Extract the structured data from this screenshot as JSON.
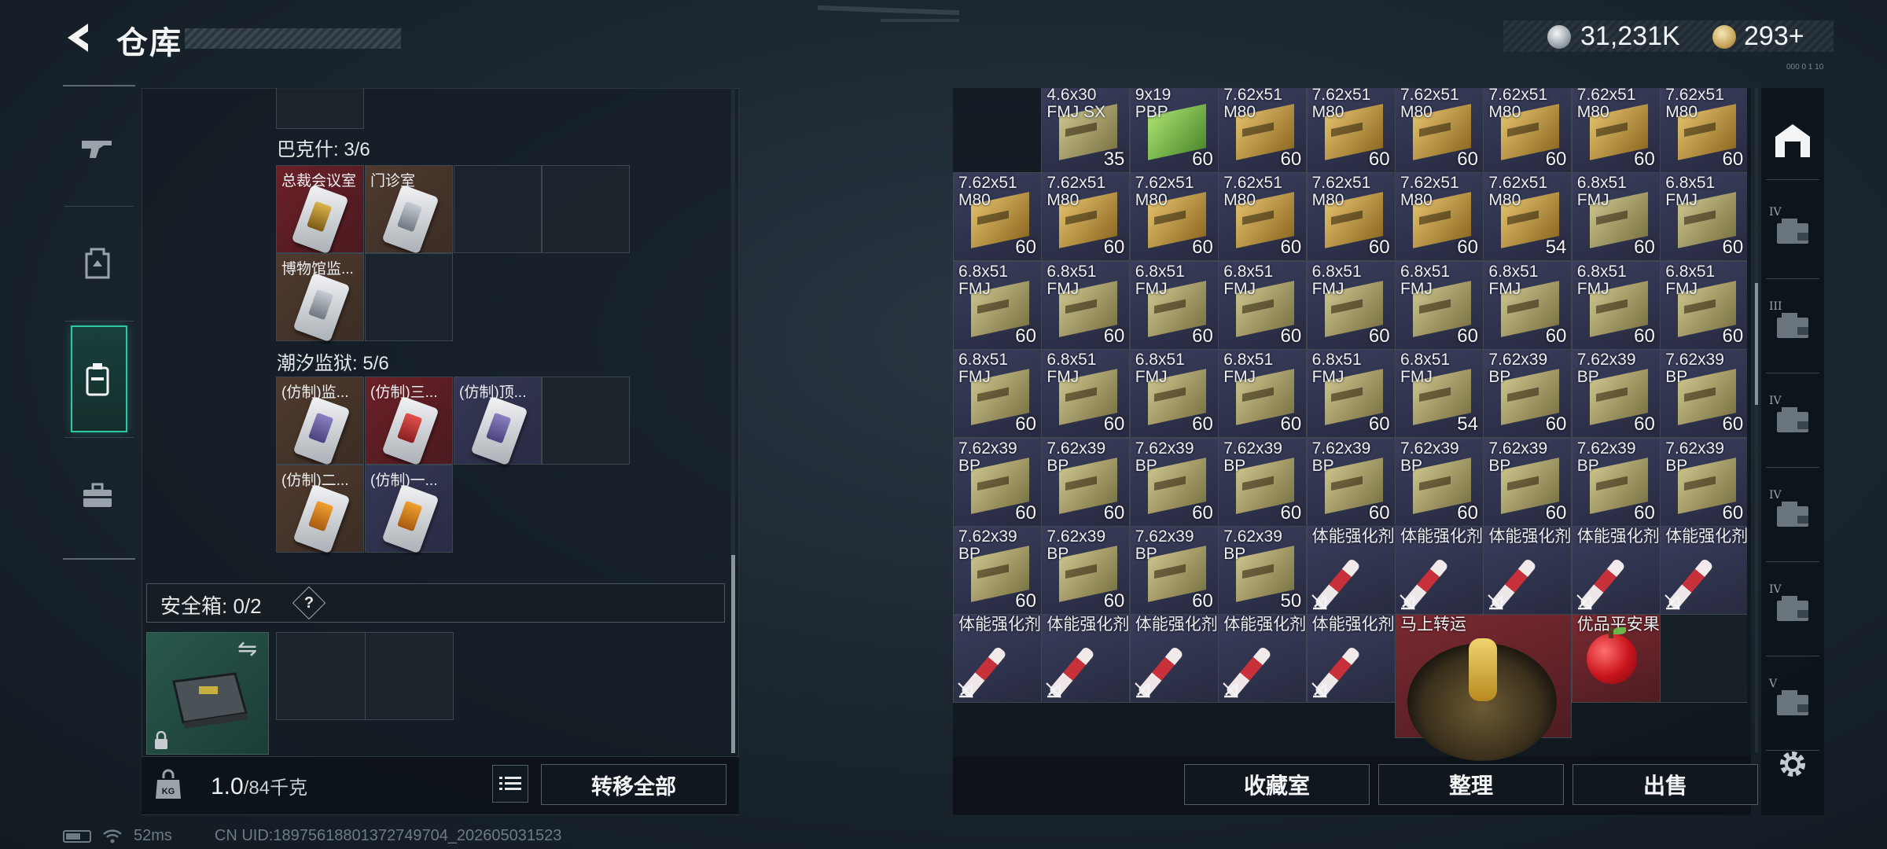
{
  "header": {
    "title": "仓库",
    "currency_silver": "31,231K",
    "currency_gold": "293",
    "plus": "+",
    "tiny": "000 0 1 10"
  },
  "sidebar": {
    "items": [
      "weapon-icon",
      "backpack-icon",
      "container-icon",
      "toolbox-icon"
    ]
  },
  "left": {
    "top_empty": "",
    "section1": {
      "label": "巴克什: 3/6",
      "items": [
        "总裁会议室",
        "门诊室",
        "博物馆监..."
      ]
    },
    "section2": {
      "label": "潮汐监狱: 5/6",
      "items": [
        "(仿制)监...",
        "(仿制)三...",
        "(仿制)顶...",
        "(仿制)二...",
        "(仿制)一..."
      ]
    },
    "safe_label": "安全箱: 0/2",
    "safe_help": "?",
    "swap": "⇋",
    "weight_value": "1.0",
    "weight_max": "/84千克",
    "transfer_all": "转移全部"
  },
  "status": {
    "ping": "52ms",
    "uid": "CN UID:18975618801372749704_202605031523"
  },
  "grid": {
    "rows": [
      [
        [
          "4.6x30\nFMJ SX",
          "35",
          "olive"
        ],
        [
          "9x19\nPBP",
          "60",
          "green"
        ],
        [
          "7.62x51\nM80",
          "60",
          "gold"
        ],
        [
          "7.62x51\nM80",
          "60",
          "gold"
        ],
        [
          "7.62x51\nM80",
          "60",
          "gold"
        ],
        [
          "7.62x51\nM80",
          "60",
          "gold"
        ],
        [
          "7.62x51\nM80",
          "60",
          "gold"
        ],
        [
          "7.62x51\nM80",
          "60",
          "gold"
        ]
      ],
      [
        [
          "7.62x51\nM80",
          "60",
          "gold"
        ],
        [
          "7.62x51\nM80",
          "60",
          "gold"
        ],
        [
          "7.62x51\nM80",
          "60",
          "gold"
        ],
        [
          "7.62x51\nM80",
          "60",
          "gold"
        ],
        [
          "7.62x51\nM80",
          "60",
          "gold"
        ],
        [
          "7.62x51\nM80",
          "60",
          "gold"
        ],
        [
          "7.62x51\nM80",
          "54",
          "gold"
        ],
        [
          "6.8x51\nFMJ",
          "60",
          "olive"
        ],
        [
          "6.8x51\nFMJ",
          "60",
          "olive"
        ]
      ],
      [
        [
          "6.8x51\nFMJ",
          "60",
          "olive"
        ],
        [
          "6.8x51\nFMJ",
          "60",
          "olive"
        ],
        [
          "6.8x51\nFMJ",
          "60",
          "olive"
        ],
        [
          "6.8x51\nFMJ",
          "60",
          "olive"
        ],
        [
          "6.8x51\nFMJ",
          "60",
          "olive"
        ],
        [
          "6.8x51\nFMJ",
          "60",
          "olive"
        ],
        [
          "6.8x51\nFMJ",
          "60",
          "olive"
        ],
        [
          "6.8x51\nFMJ",
          "60",
          "olive"
        ],
        [
          "6.8x51\nFMJ",
          "60",
          "olive"
        ]
      ],
      [
        [
          "6.8x51\nFMJ",
          "60",
          "olive"
        ],
        [
          "6.8x51\nFMJ",
          "60",
          "olive"
        ],
        [
          "6.8x51\nFMJ",
          "60",
          "olive"
        ],
        [
          "6.8x51\nFMJ",
          "60",
          "olive"
        ],
        [
          "6.8x51\nFMJ",
          "60",
          "olive"
        ],
        [
          "6.8x51\nFMJ",
          "54",
          "olive"
        ],
        [
          "7.62x39\nBP",
          "60",
          "olive"
        ],
        [
          "7.62x39\nBP",
          "60",
          "olive"
        ],
        [
          "7.62x39\nBP",
          "60",
          "olive"
        ]
      ],
      [
        [
          "7.62x39\nBP",
          "60",
          "olive"
        ],
        [
          "7.62x39\nBP",
          "60",
          "olive"
        ],
        [
          "7.62x39\nBP",
          "60",
          "olive"
        ],
        [
          "7.62x39\nBP",
          "60",
          "olive"
        ],
        [
          "7.62x39\nBP",
          "60",
          "olive"
        ],
        [
          "7.62x39\nBP",
          "60",
          "olive"
        ],
        [
          "7.62x39\nBP",
          "60",
          "olive"
        ],
        [
          "7.62x39\nBP",
          "60",
          "olive"
        ],
        [
          "7.62x39\nBP",
          "60",
          "olive"
        ]
      ],
      [
        [
          "7.62x39\nBP",
          "60",
          "olive"
        ],
        [
          "7.62x39\nBP",
          "60",
          "olive"
        ],
        [
          "7.62x39\nBP",
          "60",
          "olive"
        ],
        [
          "7.62x39\nBP",
          "50",
          "olive"
        ],
        [
          "体能强化剂",
          "",
          "syringe"
        ],
        [
          "体能强化剂",
          "",
          "syringe"
        ],
        [
          "体能强化剂",
          "",
          "syringe"
        ],
        [
          "体能强化剂",
          "",
          "syringe"
        ],
        [
          "体能强化剂",
          "",
          "syringe"
        ]
      ],
      [
        [
          "体能强化剂",
          "",
          "syringe"
        ],
        [
          "体能强化剂",
          "",
          "syringe"
        ],
        [
          "体能强化剂",
          "",
          "syringe"
        ],
        [
          "体能强化剂",
          "",
          "syringe"
        ],
        [
          "体能强化剂",
          "",
          "syringe"
        ],
        [
          "马上转运",
          "",
          "coin"
        ],
        [
          "",
          "",
          "skip"
        ],
        [
          "优品平安果",
          "",
          "apple"
        ],
        [
          "",
          "",
          "empty"
        ]
      ]
    ]
  },
  "buttons": {
    "collection": "收藏室",
    "sort": "整理",
    "sell": "出售"
  },
  "rail": [
    "IV",
    "III",
    "IV",
    "IV",
    "IV",
    "V"
  ],
  "colors": {
    "accent": "#2dc9a3",
    "panel": "#121a21"
  }
}
